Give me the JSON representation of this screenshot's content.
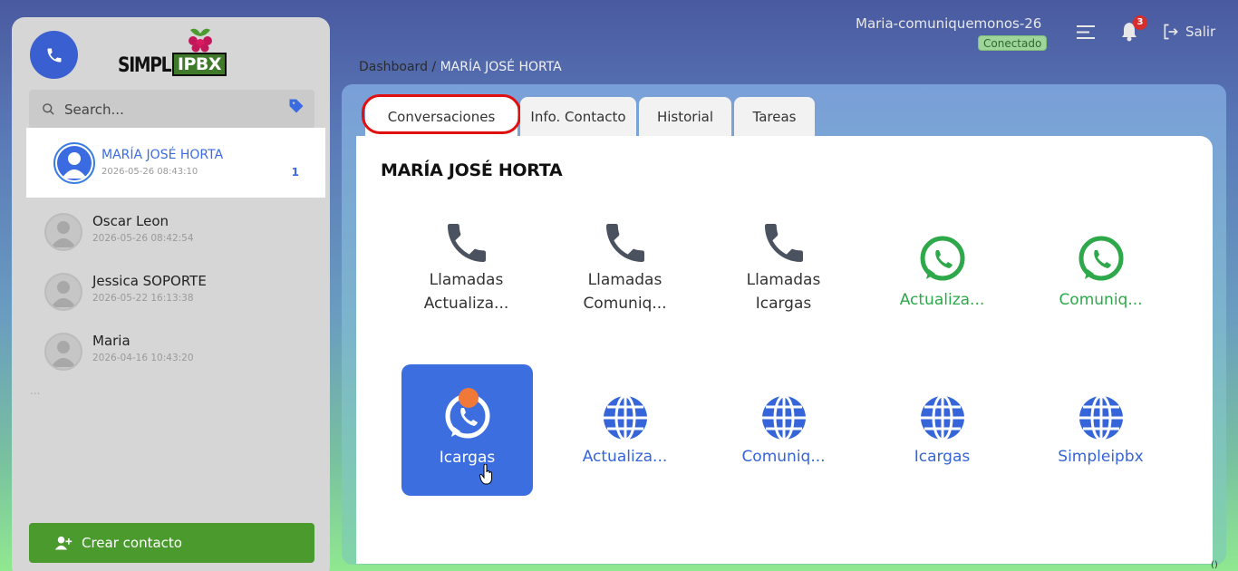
{
  "sidebar": {
    "logo": {
      "simple": "SIMPLE",
      "ipbx": "IPBX"
    },
    "search_placeholder": "Search...",
    "contacts": [
      {
        "name": "MARÍA JOSÉ HORTA",
        "date": "2026-05-26 08:43:10",
        "unread": "1",
        "active": true
      },
      {
        "name": "Oscar Leon",
        "date": "2026-05-26 08:42:54"
      },
      {
        "name": "Jessica SOPORTE",
        "date": "2026-05-22 16:13:38"
      },
      {
        "name": "Maria",
        "date": "2026-04-16 10:43:20"
      }
    ],
    "more": "...",
    "create_label": "Crear contacto"
  },
  "header": {
    "user": "Maria-comuniquemonos-26",
    "status": "Conectado",
    "notifications": "3",
    "logout": "Salir"
  },
  "breadcrumb": {
    "root": "Dashboard",
    "sep": " / ",
    "current": "MARÍA JOSÉ HORTA"
  },
  "tabs": [
    "Conversaciones",
    "Info. Contacto",
    "Historial",
    "Tareas"
  ],
  "card": {
    "title": "MARÍA JOSÉ HORTA",
    "channels_row1": [
      {
        "type": "call",
        "line1": "Llamadas",
        "line2": "Actualiza..."
      },
      {
        "type": "call",
        "line1": "Llamadas",
        "line2": "Comuniq..."
      },
      {
        "type": "call",
        "line1": "Llamadas",
        "line2": "Icargas"
      },
      {
        "type": "whatsapp",
        "line1": "Actualiza..."
      },
      {
        "type": "whatsapp",
        "line1": "Comuniq..."
      }
    ],
    "channels_row2": [
      {
        "type": "whatsapp-active",
        "line1": "Icargas"
      },
      {
        "type": "web",
        "line1": "Actualiza..."
      },
      {
        "type": "web",
        "line1": "Comuniq..."
      },
      {
        "type": "web",
        "line1": "Icargas"
      },
      {
        "type": "web",
        "line1": "Simpleipbx"
      }
    ]
  },
  "colors": {
    "accent": "#3d6ee0",
    "whatsapp": "#2ea84a",
    "create_button": "#4a9a2e",
    "highlight_ring": "#e01010"
  },
  "corner": "()"
}
